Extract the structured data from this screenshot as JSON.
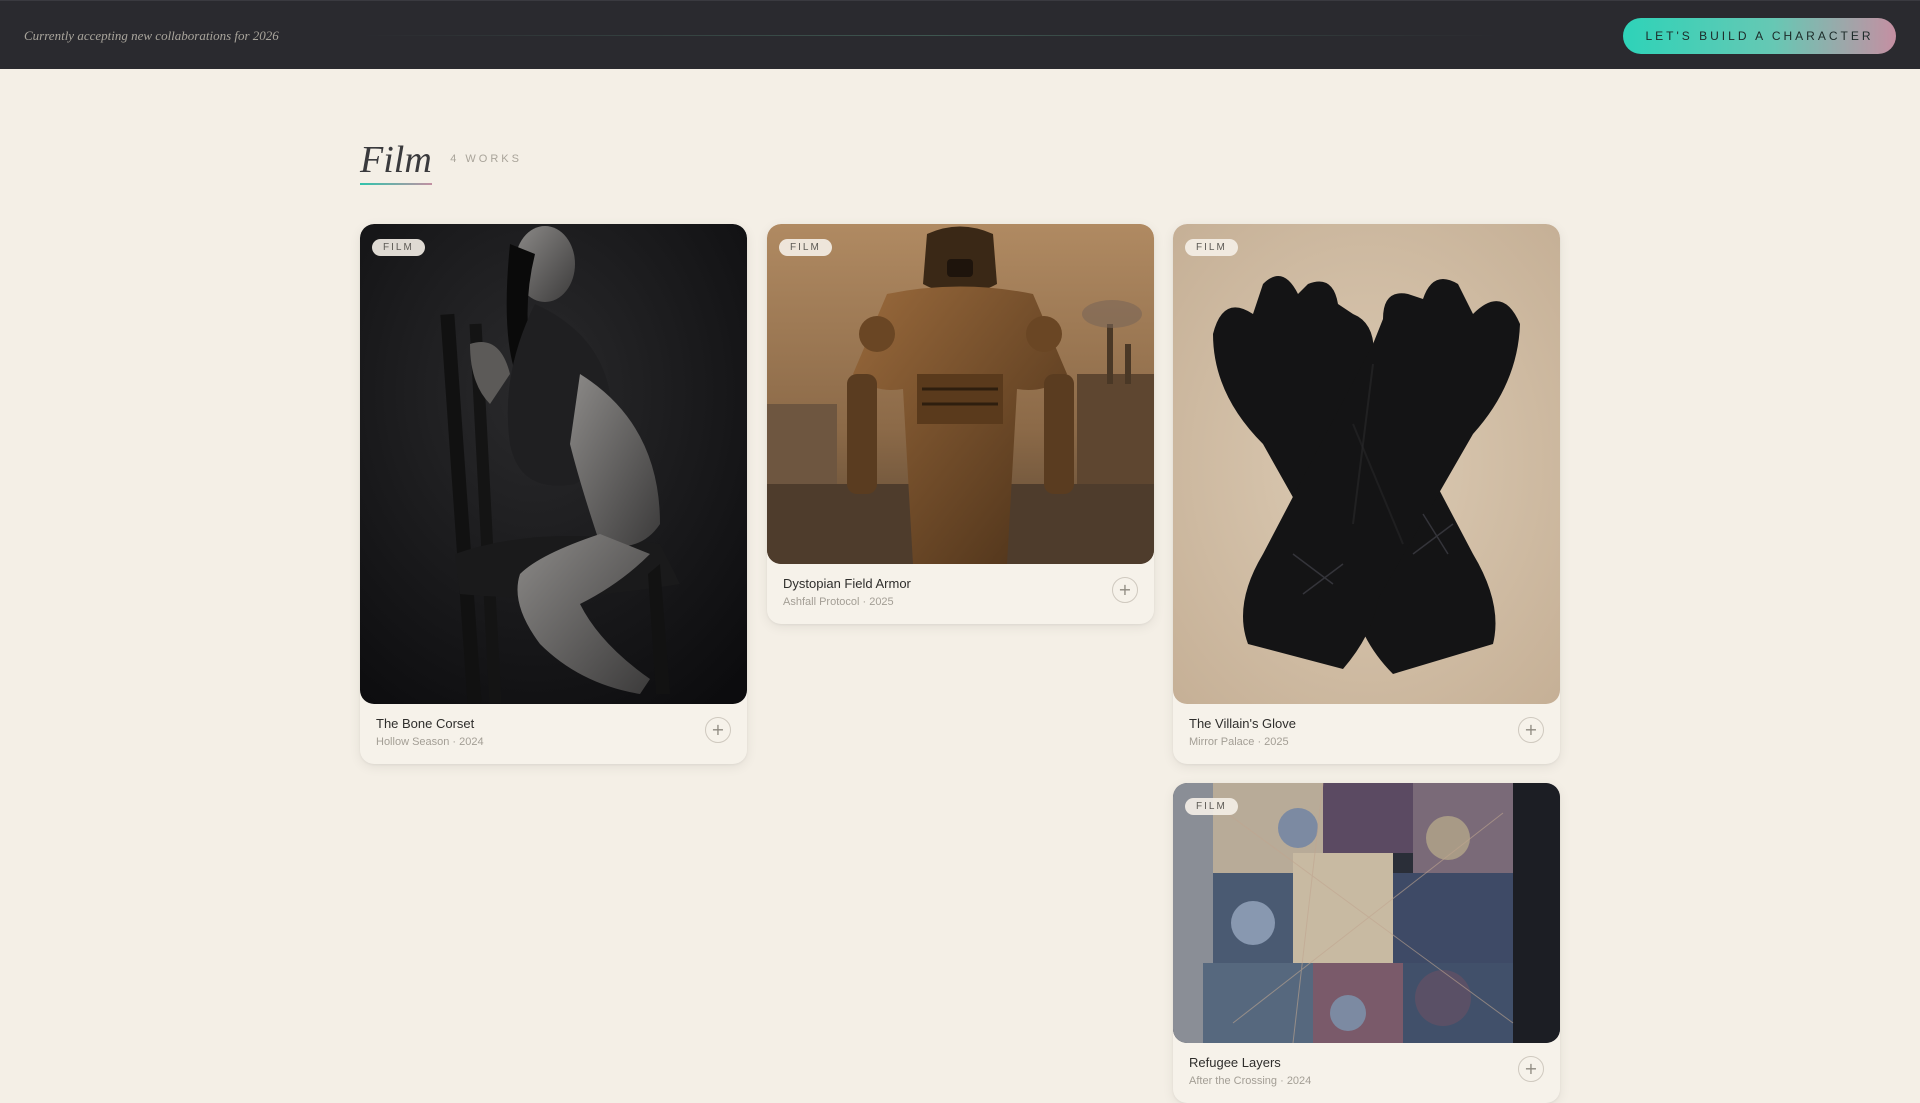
{
  "topbar": {
    "note": "Currently accepting new collaborations for 2026",
    "cta_label": "LET'S BUILD A CHARACTER"
  },
  "section": {
    "title": "Film",
    "count": "4 WORKS"
  },
  "cards": [
    {
      "tag": "FILM",
      "title": "The Bone Corset",
      "meta": "Hollow Season · 2024",
      "add": "+",
      "image": "woman-in-corset-on-chair-photo"
    },
    {
      "tag": "FILM",
      "title": "Dystopian Field Armor",
      "meta": "Ashfall Protocol · 2025",
      "add": "+",
      "image": "armored-figure-in-wasteland-photo"
    },
    {
      "tag": "FILM",
      "title": "The Villain's Glove",
      "meta": "Mirror Palace · 2025",
      "add": "+",
      "image": "black-velvet-gloves-photo"
    },
    {
      "tag": "FILM",
      "title": "Refugee Layers",
      "meta": "After the Crossing · 2024",
      "add": "+",
      "image": "patchwork-jacket-photo"
    }
  ]
}
